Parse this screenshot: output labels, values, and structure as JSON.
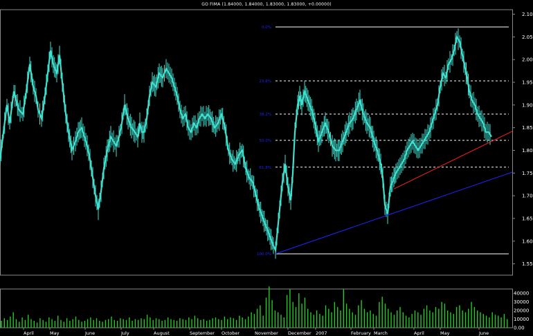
{
  "header": {
    "title": "GO FIMA (1.84000, 1.84000, 1.83000, 1.83000, +0.00000)"
  },
  "chart_data": {
    "type": "line",
    "price_axis": {
      "ticks": [
        "2.10",
        "2.05",
        "2.00",
        "1.95",
        "1.90",
        "1.85",
        "1.80",
        "1.75",
        "1.70",
        "1.65",
        "1.60",
        "1.55"
      ],
      "ylim": [
        1.525,
        2.11
      ]
    },
    "volume_axis": {
      "ticks": [
        "40000",
        "30000",
        "20000",
        "10000",
        "0.00"
      ],
      "ylim": [
        0,
        45000
      ]
    },
    "x_labels": [
      "April",
      "May",
      "June",
      "July",
      "August",
      "September",
      "October",
      "November",
      "December",
      "2007",
      "February",
      "March",
      "April",
      "May",
      "June"
    ],
    "x_label_pos": [
      34,
      72,
      123,
      175,
      222,
      274,
      320,
      368,
      416,
      456,
      507,
      540,
      598,
      636,
      692
    ],
    "x_range": [
      0,
      735
    ],
    "fib_levels": [
      {
        "label": "0.0%",
        "value": 2.072
      },
      {
        "label": "23.6%",
        "value": 1.953
      },
      {
        "label": "38.2%",
        "value": 1.88
      },
      {
        "label": "50.0%",
        "value": 1.822
      },
      {
        "label": "61.8%",
        "value": 1.763
      },
      {
        "label": "100.0%",
        "value": 1.572
      }
    ],
    "fib_range": [
      398,
      735
    ],
    "fib_label_x": 392,
    "trendlines": [
      {
        "color": "#ff2020",
        "from": [
          569,
          1.715
        ],
        "to": [
          740,
          1.842
        ]
      },
      {
        "color": "#2024ff",
        "from": [
          398,
          1.572
        ],
        "to": [
          740,
          1.752
        ]
      }
    ],
    "price_series": {
      "color": "#3fe0d0",
      "x": [
        0,
        5,
        10,
        14,
        20,
        27,
        33,
        38,
        43,
        48,
        52,
        55,
        60,
        65,
        69,
        73,
        77,
        82,
        86,
        90,
        95,
        99,
        104,
        109,
        113,
        118,
        122,
        126,
        130,
        134,
        138,
        142,
        146,
        150,
        155,
        160,
        164,
        168,
        172,
        176,
        180,
        185,
        190,
        195,
        199,
        202,
        205,
        208,
        212,
        216,
        220,
        225,
        230,
        235,
        240,
        244,
        248,
        252,
        256,
        260,
        264,
        268,
        272,
        276,
        280,
        284,
        288,
        292,
        296,
        300,
        305,
        310,
        315,
        320,
        325,
        330,
        335,
        340,
        345,
        350,
        355,
        360,
        365,
        370,
        375,
        380,
        385,
        390,
        395,
        398,
        400,
        404,
        408,
        412,
        416,
        420,
        423,
        426,
        430,
        433,
        436,
        440,
        445,
        450,
        455,
        460,
        465,
        470,
        475,
        480,
        485,
        490,
        495,
        500,
        505,
        510,
        515,
        520,
        525,
        530,
        535,
        540,
        545,
        550,
        553,
        556,
        560,
        564,
        567,
        569,
        572,
        576,
        580,
        584,
        588,
        592,
        596,
        600,
        604,
        608,
        612,
        616,
        620,
        624,
        628,
        632,
        636,
        640,
        644,
        648,
        652,
        656,
        660,
        664,
        668,
        672,
        675,
        678,
        682,
        686,
        690,
        694,
        698,
        702,
        706,
        710,
        714
      ],
      "y": [
        1.78,
        1.84,
        1.9,
        1.86,
        1.93,
        1.89,
        1.88,
        1.93,
        1.99,
        1.94,
        1.92,
        1.89,
        1.87,
        1.92,
        1.97,
        2.02,
        1.99,
        1.97,
        2.01,
        1.95,
        1.88,
        1.84,
        1.8,
        1.82,
        1.84,
        1.85,
        1.83,
        1.81,
        1.78,
        1.74,
        1.7,
        1.67,
        1.71,
        1.76,
        1.8,
        1.83,
        1.82,
        1.81,
        1.83,
        1.86,
        1.9,
        1.87,
        1.85,
        1.84,
        1.83,
        1.86,
        1.84,
        1.84,
        1.87,
        1.92,
        1.95,
        1.94,
        1.97,
        1.96,
        1.98,
        1.97,
        1.96,
        1.94,
        1.92,
        1.89,
        1.87,
        1.88,
        1.85,
        1.84,
        1.86,
        1.85,
        1.87,
        1.88,
        1.87,
        1.88,
        1.87,
        1.85,
        1.86,
        1.88,
        1.85,
        1.8,
        1.78,
        1.77,
        1.79,
        1.8,
        1.76,
        1.74,
        1.73,
        1.7,
        1.67,
        1.65,
        1.63,
        1.61,
        1.59,
        1.58,
        1.61,
        1.67,
        1.73,
        1.77,
        1.72,
        1.69,
        1.75,
        1.84,
        1.9,
        1.92,
        1.9,
        1.93,
        1.91,
        1.89,
        1.86,
        1.82,
        1.84,
        1.86,
        1.84,
        1.81,
        1.8,
        1.8,
        1.82,
        1.84,
        1.86,
        1.87,
        1.89,
        1.91,
        1.88,
        1.86,
        1.85,
        1.82,
        1.8,
        1.77,
        1.74,
        1.68,
        1.66,
        1.72,
        1.73,
        1.74,
        1.75,
        1.76,
        1.77,
        1.78,
        1.8,
        1.81,
        1.82,
        1.81,
        1.8,
        1.81,
        1.82,
        1.83,
        1.84,
        1.86,
        1.88,
        1.9,
        1.94,
        1.97,
        1.96,
        1.99,
        2.0,
        2.02,
        2.05,
        2.04,
        2.01,
        1.98,
        1.96,
        1.93,
        1.91,
        1.9,
        1.88,
        1.87,
        1.86,
        1.84,
        1.84,
        1.83
      ]
    },
    "volume_bars": [
      8,
      11,
      9,
      13,
      18,
      10,
      7,
      12,
      9,
      15,
      10,
      8,
      6,
      11,
      9,
      7,
      12,
      10,
      8,
      14,
      9,
      7,
      11,
      8,
      10,
      13,
      9,
      7,
      8,
      10,
      12,
      9,
      11,
      8,
      7,
      9,
      10,
      13,
      9,
      8,
      11,
      10,
      9,
      12,
      8,
      10,
      9,
      11,
      10,
      15,
      12,
      9,
      11,
      10,
      8,
      9,
      12,
      10,
      9,
      8,
      11,
      10,
      9,
      12,
      10,
      14,
      11,
      9,
      10,
      8,
      9,
      11,
      12,
      10,
      9,
      13,
      10,
      12,
      11,
      9,
      14,
      12,
      10,
      13,
      18,
      16,
      22,
      26,
      14,
      35,
      48,
      32,
      20,
      18,
      15,
      12,
      38,
      45,
      30,
      24,
      40,
      28,
      35,
      22,
      18,
      15,
      20,
      16,
      14,
      26,
      22,
      18,
      30,
      24,
      20,
      45,
      28,
      22,
      18,
      15,
      26,
      32,
      22,
      18,
      20,
      16,
      14,
      30,
      36,
      28,
      22,
      18,
      15,
      20,
      24,
      18,
      14,
      12,
      16,
      20,
      18,
      15,
      22,
      26,
      20,
      18,
      24,
      22,
      30,
      28,
      20,
      18,
      16,
      24,
      26,
      20,
      18,
      22,
      30,
      24,
      20,
      18,
      16,
      14,
      12,
      18,
      15,
      14,
      12,
      16,
      10
    ]
  }
}
